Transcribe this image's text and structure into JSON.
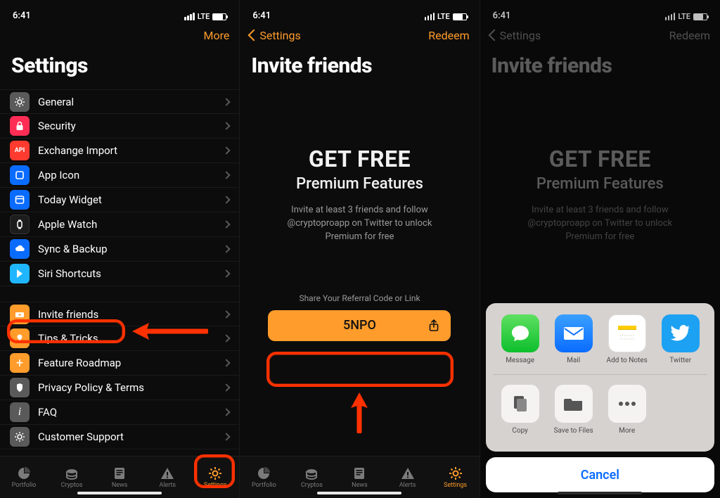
{
  "status": {
    "time": "6:41",
    "net": "LTE"
  },
  "panel1": {
    "nav_right": "More",
    "title": "Settings",
    "groups": [
      [
        {
          "key": "general",
          "label": "General",
          "icon": "i-gear"
        },
        {
          "key": "security",
          "label": "Security",
          "icon": "i-lock"
        },
        {
          "key": "import",
          "label": "Exchange Import",
          "icon": "i-api"
        },
        {
          "key": "appicon",
          "label": "App Icon",
          "icon": "i-app"
        },
        {
          "key": "today",
          "label": "Today Widget",
          "icon": "i-today"
        },
        {
          "key": "watch",
          "label": "Apple Watch",
          "icon": "i-watch"
        },
        {
          "key": "sync",
          "label": "Sync & Backup",
          "icon": "i-cloud"
        },
        {
          "key": "siri",
          "label": "Siri Shortcuts",
          "icon": "i-siri"
        }
      ],
      [
        {
          "key": "invite",
          "label": "Invite friends",
          "icon": "i-invite"
        },
        {
          "key": "tips",
          "label": "Tips & Tricks",
          "icon": "i-tips"
        },
        {
          "key": "roadmap",
          "label": "Feature Roadmap",
          "icon": "i-plus"
        },
        {
          "key": "privacy",
          "label": "Privacy Policy & Terms",
          "icon": "i-privacy"
        },
        {
          "key": "faq",
          "label": "FAQ",
          "icon": "i-faq"
        },
        {
          "key": "support",
          "label": "Customer Support",
          "icon": "i-gear"
        }
      ]
    ]
  },
  "panel2": {
    "back": "Settings",
    "redeem": "Redeem",
    "title": "Invite friends",
    "hero1": "GET FREE",
    "hero2": "Premium Features",
    "desc": "Invite at least 3 friends and follow @cryptoproapp on Twitter to unlock Premium for free",
    "share_label": "Share Your Referral Code or Link",
    "code": "5NPO"
  },
  "panel3": {
    "back": "Settings",
    "redeem": "Redeem",
    "title": "Invite friends",
    "hero1": "GET FREE",
    "hero2": "Premium Features",
    "desc": "Invite at least 3 friends and follow @cryptoproapp on Twitter to unlock Premium for free",
    "share": {
      "row1": [
        {
          "key": "message",
          "label": "Message"
        },
        {
          "key": "mail",
          "label": "Mail"
        },
        {
          "key": "notes",
          "label": "Add to Notes"
        },
        {
          "key": "twitter",
          "label": "Twitter"
        }
      ],
      "row2": [
        {
          "key": "copy",
          "label": "Copy"
        },
        {
          "key": "files",
          "label": "Save to Files"
        },
        {
          "key": "more",
          "label": "More"
        }
      ],
      "cancel": "Cancel"
    }
  },
  "tabs": [
    {
      "key": "portfolio",
      "label": "Portfolio"
    },
    {
      "key": "cryptos",
      "label": "Cryptos"
    },
    {
      "key": "news",
      "label": "News"
    },
    {
      "key": "alerts",
      "label": "Alerts"
    },
    {
      "key": "settings",
      "label": "Settings"
    }
  ]
}
